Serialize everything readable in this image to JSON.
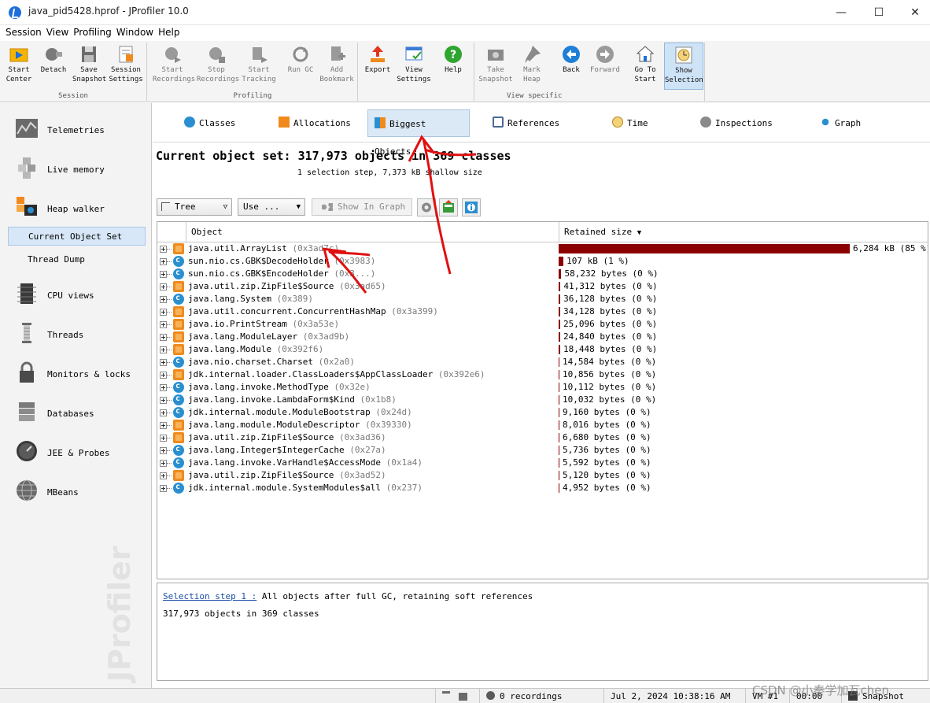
{
  "window": {
    "title": "java_pid5428.hprof - JProfiler 10.0",
    "min": "—",
    "max": "☐",
    "close": "✕"
  },
  "menu": [
    "Session",
    "View",
    "Profiling",
    "Window",
    "Help"
  ],
  "toolbar": {
    "groups": {
      "session": "Session",
      "profiling": "Profiling",
      "view_specific": "View specific"
    },
    "buttons": {
      "start_center": "Start\nCenter",
      "detach": "Detach",
      "save_snapshot": "Save\nSnapshot",
      "session_settings": "Session\nSettings",
      "start_recordings": "Start\nRecordings",
      "stop_recordings": "Stop\nRecordings",
      "start_tracking": "Start\nTracking",
      "run_gc": "Run GC",
      "add_bookmark": "Add\nBookmark",
      "export": "Export",
      "view_settings": "View\nSettings",
      "help": "Help",
      "take_snapshot": "Take\nSnapshot",
      "mark_heap": "Mark\nHeap",
      "back": "Back",
      "forward": "Forward",
      "go_to_start": "Go To\nStart",
      "show_selection": "Show\nSelection"
    }
  },
  "sidebar": {
    "items": {
      "telemetries": "Telemetries",
      "live_memory": "Live memory",
      "heap_walker": "Heap walker",
      "current_object_set": "Current Object Set",
      "thread_dump": "Thread Dump",
      "cpu_views": "CPU views",
      "threads": "Threads",
      "monitors_locks": "Monitors & locks",
      "databases": "Databases",
      "jee_probes": "JEE & Probes",
      "mbeans": "MBeans"
    },
    "watermark": "JProfiler"
  },
  "tabs": {
    "classes": "Classes",
    "allocations": "Allocations",
    "biggest_objects": "Biggest Objects",
    "references": "References",
    "time": "Time",
    "inspections": "Inspections",
    "graph": "Graph"
  },
  "summary": {
    "title": "Current object set: 317,973 objects in 369 classes",
    "subtitle": "1 selection step, 7,373 kB shallow size"
  },
  "controls": {
    "view_mode": "Tree",
    "use": "Use ...",
    "show_in_graph": "Show In Graph"
  },
  "table": {
    "col_object": "Object",
    "col_retained": "Retained size",
    "rows": [
      {
        "name": "java.util.ArrayList",
        "addr": "(0x3ad7c)",
        "size": "6,284 kB (85 %)",
        "pct": 85,
        "icon": "cube"
      },
      {
        "name": "sun.nio.cs.GBK$DecodeHolder",
        "addr": "(0x3983)",
        "size": "107 kB (1 %)",
        "pct": 1.4,
        "icon": "class"
      },
      {
        "name": "sun.nio.cs.GBK$EncodeHolder",
        "addr": "(0x3...)",
        "size": "58,232 bytes (0 %)",
        "pct": 0.8,
        "icon": "class"
      },
      {
        "name": "java.util.zip.ZipFile$Source",
        "addr": "(0x3ad65)",
        "size": "41,312 bytes (0 %)",
        "pct": 0.55,
        "icon": "cube"
      },
      {
        "name": "java.lang.System",
        "addr": "(0x389)",
        "size": "36,128 bytes (0 %)",
        "pct": 0.5,
        "icon": "class"
      },
      {
        "name": "java.util.concurrent.ConcurrentHashMap",
        "addr": "(0x3a399)",
        "size": "34,128 bytes (0 %)",
        "pct": 0.45,
        "icon": "cube"
      },
      {
        "name": "java.io.PrintStream",
        "addr": "(0x3a53e)",
        "size": "25,096 bytes (0 %)",
        "pct": 0.35,
        "icon": "cube"
      },
      {
        "name": "java.lang.ModuleLayer",
        "addr": "(0x3ad9b)",
        "size": "24,840 bytes (0 %)",
        "pct": 0.33,
        "icon": "cube"
      },
      {
        "name": "java.lang.Module",
        "addr": "(0x392f6)",
        "size": "18,448 bytes (0 %)",
        "pct": 0.25,
        "icon": "cube"
      },
      {
        "name": "java.nio.charset.Charset",
        "addr": "(0x2a0)",
        "size": "14,584 bytes (0 %)",
        "pct": 0,
        "icon": "class"
      },
      {
        "name": "jdk.internal.loader.ClassLoaders$AppClassLoader",
        "addr": "(0x392e6)",
        "size": "10,856 bytes (0 %)",
        "pct": 0,
        "icon": "cube"
      },
      {
        "name": "java.lang.invoke.MethodType",
        "addr": "(0x32e)",
        "size": "10,112 bytes (0 %)",
        "pct": 0,
        "icon": "class"
      },
      {
        "name": "java.lang.invoke.LambdaForm$Kind",
        "addr": "(0x1b8)",
        "size": "10,032 bytes (0 %)",
        "pct": 0,
        "icon": "class"
      },
      {
        "name": "jdk.internal.module.ModuleBootstrap",
        "addr": "(0x24d)",
        "size": "9,160 bytes (0 %)",
        "pct": 0,
        "icon": "class"
      },
      {
        "name": "java.lang.module.ModuleDescriptor",
        "addr": "(0x39330)",
        "size": "8,016 bytes (0 %)",
        "pct": 0,
        "icon": "cube"
      },
      {
        "name": "java.util.zip.ZipFile$Source",
        "addr": "(0x3ad36)",
        "size": "6,680 bytes (0 %)",
        "pct": 0,
        "icon": "cube"
      },
      {
        "name": "java.lang.Integer$IntegerCache",
        "addr": "(0x27a)",
        "size": "5,736 bytes (0 %)",
        "pct": 0,
        "icon": "class"
      },
      {
        "name": "java.lang.invoke.VarHandle$AccessMode",
        "addr": "(0x1a4)",
        "size": "5,592 bytes (0 %)",
        "pct": 0,
        "icon": "class"
      },
      {
        "name": "java.util.zip.ZipFile$Source",
        "addr": "(0x3ad52)",
        "size": "5,120 bytes (0 %)",
        "pct": 0,
        "icon": "cube"
      },
      {
        "name": "jdk.internal.module.SystemModules$all",
        "addr": "(0x237)",
        "size": "4,952 bytes (0 %)",
        "pct": 0,
        "icon": "class"
      }
    ]
  },
  "info": {
    "step_link": "Selection step 1 :",
    "step_text": " All objects after full GC, retaining soft references",
    "count": "317,973 objects in 369 classes"
  },
  "status": {
    "recordings": "0 recordings",
    "datetime": "Jul 2, 2024 10:38:16 AM",
    "vm": "VM #1",
    "elapsed": "00:00",
    "mode": "Snapshot"
  },
  "watermark_csdn": "CSDN @小秦学加瓦chen"
}
